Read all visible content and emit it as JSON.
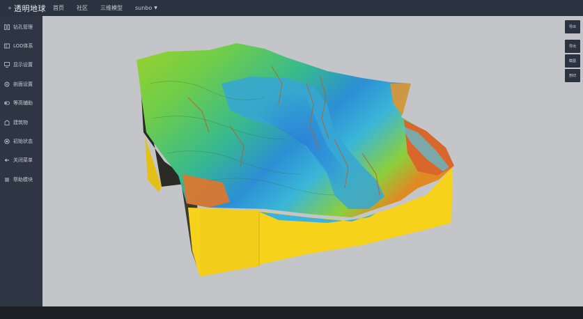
{
  "header": {
    "logo_text": "透明地球",
    "nav": [
      "首页",
      "社区",
      "三维模型",
      "sunbo"
    ]
  },
  "sidebar": {
    "items": [
      {
        "label": "钻孔管理",
        "icon": "grid-icon"
      },
      {
        "label": "LOD体系",
        "icon": "layers-icon"
      },
      {
        "label": "显示设置",
        "icon": "display-icon"
      },
      {
        "label": "剖面设置",
        "icon": "settings-icon"
      },
      {
        "label": "等高辅助",
        "icon": "toggle-icon"
      },
      {
        "label": "建筑物",
        "icon": "building-icon"
      },
      {
        "label": "初始状态",
        "icon": "reset-icon"
      },
      {
        "label": "关闭菜单",
        "icon": "back-arrow-icon"
      },
      {
        "label": "帮助模块",
        "icon": "menu-icon"
      }
    ]
  },
  "right_tools": [
    "导出",
    "导出",
    "截图",
    "剖切"
  ],
  "colors": {
    "topbar": "#2c3340",
    "sidebar": "#2f3643",
    "canvas": "#c3c5c8",
    "model_side": "#f7d21c"
  }
}
